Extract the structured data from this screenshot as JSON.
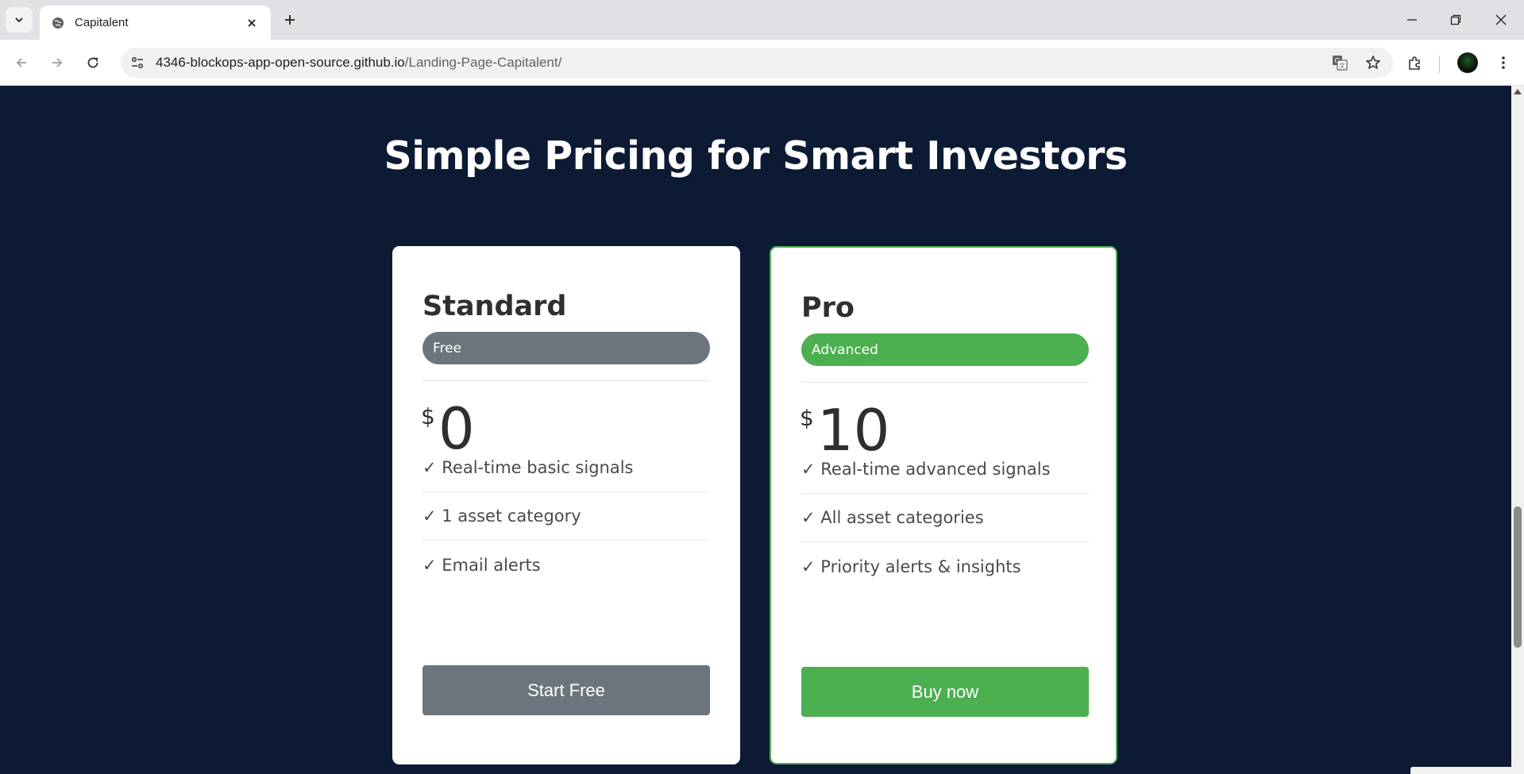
{
  "browser": {
    "tab_title": "Capitalent",
    "url_host": "4346-blockops-app-open-source.github.io",
    "url_path": "/Landing-Page-Capitalent/"
  },
  "page": {
    "heading": "Simple Pricing for Smart Investors"
  },
  "plans": [
    {
      "name": "Standard",
      "badge": "Free",
      "currency": "$",
      "price": "0",
      "features": [
        "✓ Real-time basic signals",
        "✓ 1 asset category",
        "✓ Email alerts"
      ],
      "cta": "Start Free",
      "accent": "#6c757d"
    },
    {
      "name": "Pro",
      "badge": "Advanced",
      "currency": "$",
      "price": "10",
      "features": [
        "✓ Real-time advanced signals",
        "✓ All asset categories",
        "✓ Priority alerts & insights"
      ],
      "cta": "Buy now",
      "accent": "#4caf50"
    }
  ],
  "colors": {
    "page_bg": "#0c1a34",
    "card_bg": "#ffffff",
    "grey_accent": "#6c757d",
    "green_accent": "#4caf50"
  },
  "icons": [
    "tab-search-icon",
    "globe-icon",
    "close-icon",
    "plus-icon",
    "minimize-icon",
    "restore-icon",
    "window-close-icon",
    "back-icon",
    "forward-icon",
    "reload-icon",
    "site-info-icon",
    "translate-icon",
    "bookmark-star-icon",
    "extensions-icon",
    "kebab-menu-icon"
  ]
}
